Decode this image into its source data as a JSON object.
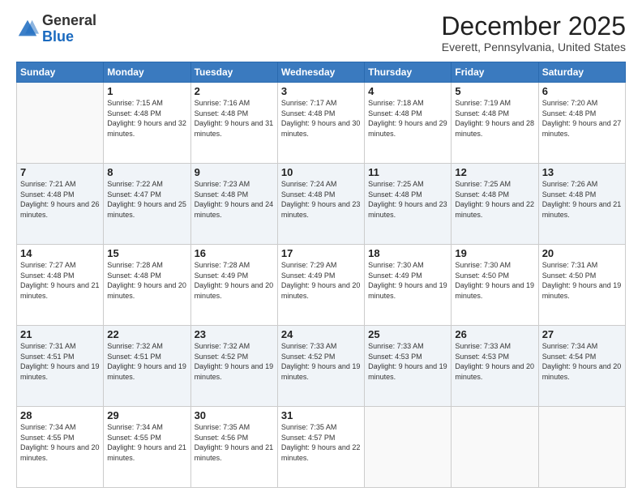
{
  "logo": {
    "general": "General",
    "blue": "Blue"
  },
  "header": {
    "month": "December 2025",
    "location": "Everett, Pennsylvania, United States"
  },
  "days_of_week": [
    "Sunday",
    "Monday",
    "Tuesday",
    "Wednesday",
    "Thursday",
    "Friday",
    "Saturday"
  ],
  "weeks": [
    [
      {
        "day": "",
        "sunrise": "",
        "sunset": "",
        "daylight": ""
      },
      {
        "day": "1",
        "sunrise": "Sunrise: 7:15 AM",
        "sunset": "Sunset: 4:48 PM",
        "daylight": "Daylight: 9 hours and 32 minutes."
      },
      {
        "day": "2",
        "sunrise": "Sunrise: 7:16 AM",
        "sunset": "Sunset: 4:48 PM",
        "daylight": "Daylight: 9 hours and 31 minutes."
      },
      {
        "day": "3",
        "sunrise": "Sunrise: 7:17 AM",
        "sunset": "Sunset: 4:48 PM",
        "daylight": "Daylight: 9 hours and 30 minutes."
      },
      {
        "day": "4",
        "sunrise": "Sunrise: 7:18 AM",
        "sunset": "Sunset: 4:48 PM",
        "daylight": "Daylight: 9 hours and 29 minutes."
      },
      {
        "day": "5",
        "sunrise": "Sunrise: 7:19 AM",
        "sunset": "Sunset: 4:48 PM",
        "daylight": "Daylight: 9 hours and 28 minutes."
      },
      {
        "day": "6",
        "sunrise": "Sunrise: 7:20 AM",
        "sunset": "Sunset: 4:48 PM",
        "daylight": "Daylight: 9 hours and 27 minutes."
      }
    ],
    [
      {
        "day": "7",
        "sunrise": "Sunrise: 7:21 AM",
        "sunset": "Sunset: 4:48 PM",
        "daylight": "Daylight: 9 hours and 26 minutes."
      },
      {
        "day": "8",
        "sunrise": "Sunrise: 7:22 AM",
        "sunset": "Sunset: 4:47 PM",
        "daylight": "Daylight: 9 hours and 25 minutes."
      },
      {
        "day": "9",
        "sunrise": "Sunrise: 7:23 AM",
        "sunset": "Sunset: 4:48 PM",
        "daylight": "Daylight: 9 hours and 24 minutes."
      },
      {
        "day": "10",
        "sunrise": "Sunrise: 7:24 AM",
        "sunset": "Sunset: 4:48 PM",
        "daylight": "Daylight: 9 hours and 23 minutes."
      },
      {
        "day": "11",
        "sunrise": "Sunrise: 7:25 AM",
        "sunset": "Sunset: 4:48 PM",
        "daylight": "Daylight: 9 hours and 23 minutes."
      },
      {
        "day": "12",
        "sunrise": "Sunrise: 7:25 AM",
        "sunset": "Sunset: 4:48 PM",
        "daylight": "Daylight: 9 hours and 22 minutes."
      },
      {
        "day": "13",
        "sunrise": "Sunrise: 7:26 AM",
        "sunset": "Sunset: 4:48 PM",
        "daylight": "Daylight: 9 hours and 21 minutes."
      }
    ],
    [
      {
        "day": "14",
        "sunrise": "Sunrise: 7:27 AM",
        "sunset": "Sunset: 4:48 PM",
        "daylight": "Daylight: 9 hours and 21 minutes."
      },
      {
        "day": "15",
        "sunrise": "Sunrise: 7:28 AM",
        "sunset": "Sunset: 4:48 PM",
        "daylight": "Daylight: 9 hours and 20 minutes."
      },
      {
        "day": "16",
        "sunrise": "Sunrise: 7:28 AM",
        "sunset": "Sunset: 4:49 PM",
        "daylight": "Daylight: 9 hours and 20 minutes."
      },
      {
        "day": "17",
        "sunrise": "Sunrise: 7:29 AM",
        "sunset": "Sunset: 4:49 PM",
        "daylight": "Daylight: 9 hours and 20 minutes."
      },
      {
        "day": "18",
        "sunrise": "Sunrise: 7:30 AM",
        "sunset": "Sunset: 4:49 PM",
        "daylight": "Daylight: 9 hours and 19 minutes."
      },
      {
        "day": "19",
        "sunrise": "Sunrise: 7:30 AM",
        "sunset": "Sunset: 4:50 PM",
        "daylight": "Daylight: 9 hours and 19 minutes."
      },
      {
        "day": "20",
        "sunrise": "Sunrise: 7:31 AM",
        "sunset": "Sunset: 4:50 PM",
        "daylight": "Daylight: 9 hours and 19 minutes."
      }
    ],
    [
      {
        "day": "21",
        "sunrise": "Sunrise: 7:31 AM",
        "sunset": "Sunset: 4:51 PM",
        "daylight": "Daylight: 9 hours and 19 minutes."
      },
      {
        "day": "22",
        "sunrise": "Sunrise: 7:32 AM",
        "sunset": "Sunset: 4:51 PM",
        "daylight": "Daylight: 9 hours and 19 minutes."
      },
      {
        "day": "23",
        "sunrise": "Sunrise: 7:32 AM",
        "sunset": "Sunset: 4:52 PM",
        "daylight": "Daylight: 9 hours and 19 minutes."
      },
      {
        "day": "24",
        "sunrise": "Sunrise: 7:33 AM",
        "sunset": "Sunset: 4:52 PM",
        "daylight": "Daylight: 9 hours and 19 minutes."
      },
      {
        "day": "25",
        "sunrise": "Sunrise: 7:33 AM",
        "sunset": "Sunset: 4:53 PM",
        "daylight": "Daylight: 9 hours and 19 minutes."
      },
      {
        "day": "26",
        "sunrise": "Sunrise: 7:33 AM",
        "sunset": "Sunset: 4:53 PM",
        "daylight": "Daylight: 9 hours and 20 minutes."
      },
      {
        "day": "27",
        "sunrise": "Sunrise: 7:34 AM",
        "sunset": "Sunset: 4:54 PM",
        "daylight": "Daylight: 9 hours and 20 minutes."
      }
    ],
    [
      {
        "day": "28",
        "sunrise": "Sunrise: 7:34 AM",
        "sunset": "Sunset: 4:55 PM",
        "daylight": "Daylight: 9 hours and 20 minutes."
      },
      {
        "day": "29",
        "sunrise": "Sunrise: 7:34 AM",
        "sunset": "Sunset: 4:55 PM",
        "daylight": "Daylight: 9 hours and 21 minutes."
      },
      {
        "day": "30",
        "sunrise": "Sunrise: 7:35 AM",
        "sunset": "Sunset: 4:56 PM",
        "daylight": "Daylight: 9 hours and 21 minutes."
      },
      {
        "day": "31",
        "sunrise": "Sunrise: 7:35 AM",
        "sunset": "Sunset: 4:57 PM",
        "daylight": "Daylight: 9 hours and 22 minutes."
      },
      {
        "day": "",
        "sunrise": "",
        "sunset": "",
        "daylight": ""
      },
      {
        "day": "",
        "sunrise": "",
        "sunset": "",
        "daylight": ""
      },
      {
        "day": "",
        "sunrise": "",
        "sunset": "",
        "daylight": ""
      }
    ]
  ]
}
